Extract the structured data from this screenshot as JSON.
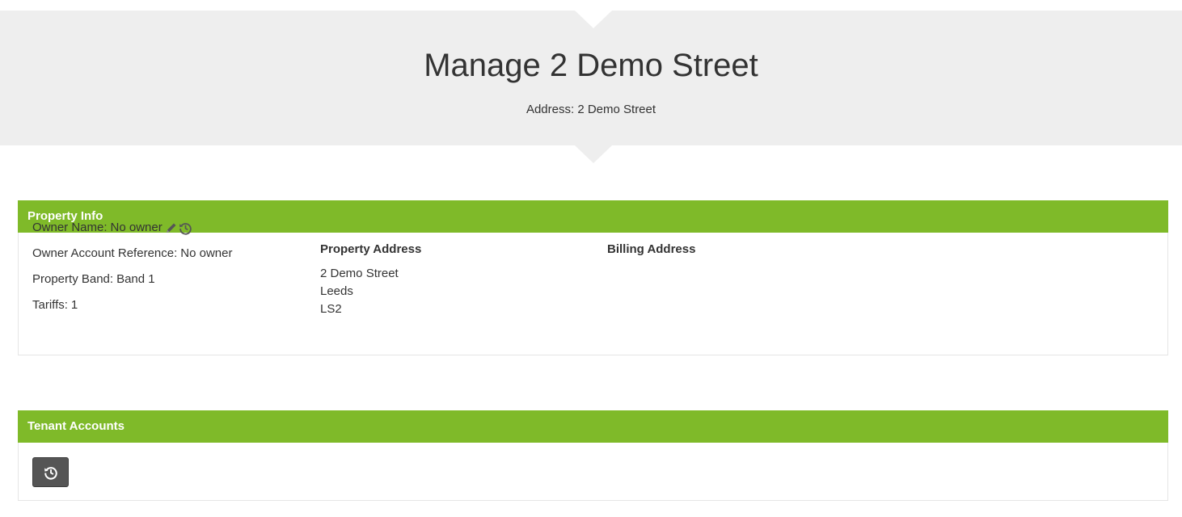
{
  "header": {
    "title": "Manage 2 Demo Street",
    "address_label": "Address:",
    "address_value": "2 Demo Street"
  },
  "property_info": {
    "panel_title": "Property Info",
    "owner_name_label": "Owner Name:",
    "owner_name_value": "No owner",
    "owner_ref_label": "Owner Account Reference:",
    "owner_ref_value": "No owner",
    "band_label": "Property Band:",
    "band_value": "Band 1",
    "tariffs_label": "Tariffs:",
    "tariffs_value": "1",
    "property_address_heading": "Property Address",
    "property_address_lines": [
      "2 Demo Street",
      "Leeds",
      "LS2"
    ],
    "billing_address_heading": "Billing Address"
  },
  "tenant_accounts": {
    "panel_title": "Tenant Accounts",
    "history_button_icon": "history-icon"
  },
  "colors": {
    "accent": "#7fba29",
    "hero_bg": "#eeeeee",
    "button_bg": "#555555"
  }
}
